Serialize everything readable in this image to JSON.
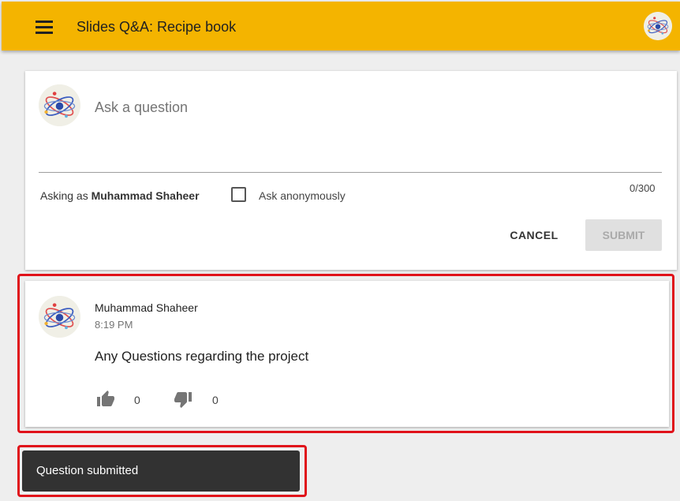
{
  "header": {
    "title": "Slides Q&A: Recipe book",
    "background": "#f4b400"
  },
  "ask_form": {
    "placeholder": "Ask a question",
    "asking_as_prefix": "Asking as ",
    "user_name": "Muhammad Shaheer",
    "anonymous_label": "Ask anonymously",
    "anonymous_checked": false,
    "char_count": "0/300",
    "cancel_label": "CANCEL",
    "submit_label": "SUBMIT"
  },
  "question": {
    "author": "Muhammad Shaheer",
    "time": "8:19 PM",
    "text": "Any Questions regarding the project",
    "upvotes": "0",
    "downvotes": "0"
  },
  "snackbar": {
    "message": "Question submitted"
  },
  "highlight_color": "#e0121a"
}
